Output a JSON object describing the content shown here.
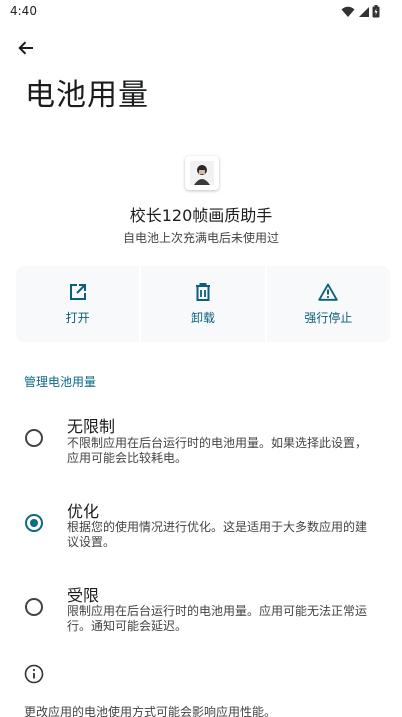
{
  "status_bar": {
    "time": "4:40"
  },
  "page": {
    "title": "电池用量"
  },
  "app": {
    "name": "校长120帧画质助手",
    "status": "自电池上次充满电后未使用过"
  },
  "actions": [
    {
      "label": "打开",
      "icon": "open-external-icon"
    },
    {
      "label": "卸载",
      "icon": "trash-icon"
    },
    {
      "label": "强行停止",
      "icon": "warning-icon"
    }
  ],
  "section": {
    "header": "管理电池用量"
  },
  "options": [
    {
      "title": "无限制",
      "desc": "不限制应用在后台运行时的电池用量。如果选择此设置，应用可能会比较耗电。",
      "checked": false
    },
    {
      "title": "优化",
      "desc": "根据您的使用情况进行优化。这是适用于大多数应用的建议设置。",
      "checked": true
    },
    {
      "title": "受限",
      "desc": "限制应用在后台运行时的电池用量。应用可能无法正常运行。通知可能会延迟。",
      "checked": false
    }
  ],
  "footer": {
    "text": "更改应用的电池使用方式可能会影响应用性能。"
  },
  "colors": {
    "accent": "#0a6a85",
    "action_bg": "#f7f9fb"
  }
}
